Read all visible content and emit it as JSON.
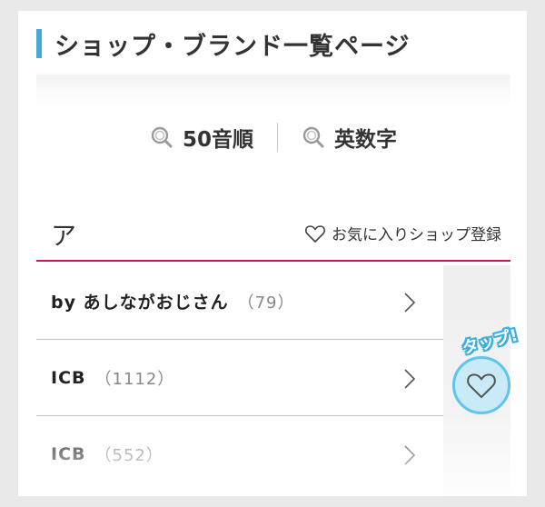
{
  "page_title": "ショップ・ブランド一覧ページ",
  "tabs": [
    {
      "label": "50音順",
      "icon": "search-icon"
    },
    {
      "label": "英数字",
      "icon": "search-icon"
    }
  ],
  "section": {
    "letter": "ア",
    "favorite_register_label": "お気に入りショップ登録",
    "favorite_icon": "heart-outline-icon"
  },
  "shops": [
    {
      "name": "by あしながおじさん",
      "count": "（79）"
    },
    {
      "name": "ICB",
      "count": "（1112）"
    },
    {
      "name": "ICB",
      "count": "（552）"
    }
  ],
  "tap_hint": {
    "label": "タップ!",
    "icon": "heart-outline-icon"
  },
  "colors": {
    "accent_bar": "#45a8d6",
    "section_underline": "#d2135e",
    "tap_highlight": "#5ec5ec"
  }
}
